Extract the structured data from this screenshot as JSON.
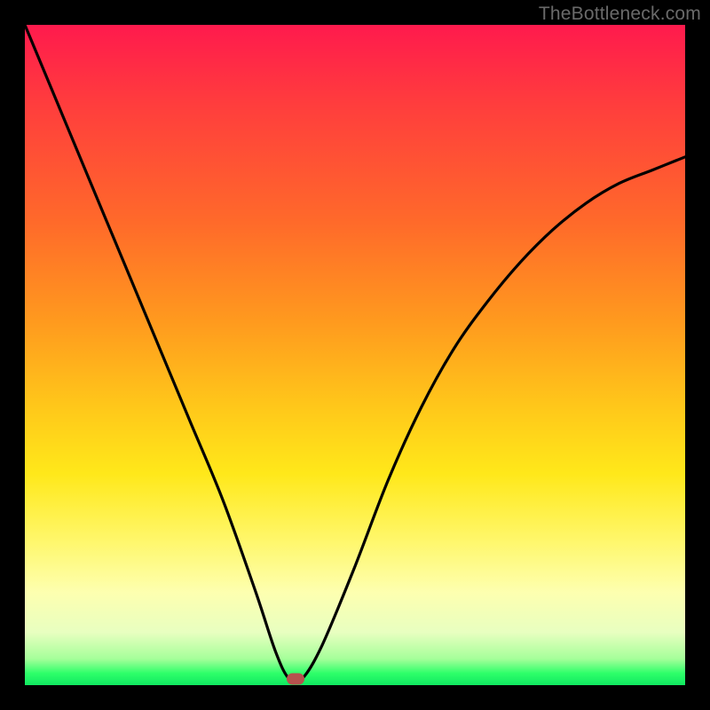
{
  "watermark": "TheBottleneck.com",
  "chart_data": {
    "type": "line",
    "title": "",
    "xlabel": "",
    "ylabel": "",
    "xlim": [
      0,
      100
    ],
    "ylim": [
      0,
      100
    ],
    "grid": false,
    "legend": false,
    "series": [
      {
        "name": "curve",
        "x": [
          0,
          5,
          10,
          15,
          20,
          25,
          30,
          35,
          38,
          40,
          42,
          45,
          50,
          55,
          60,
          65,
          70,
          75,
          80,
          85,
          90,
          95,
          100
        ],
        "y": [
          100,
          88,
          76,
          64,
          52,
          40,
          28,
          14,
          5,
          1,
          1,
          6,
          18,
          31,
          42,
          51,
          58,
          64,
          69,
          73,
          76,
          78,
          80
        ]
      }
    ],
    "annotations": [
      {
        "name": "marker",
        "x": 41,
        "y": 1,
        "color": "#b6524e"
      }
    ],
    "background_gradient": {
      "top": "#ff1a4d",
      "mid": "#ffe81a",
      "bottom": "#10e860"
    }
  }
}
